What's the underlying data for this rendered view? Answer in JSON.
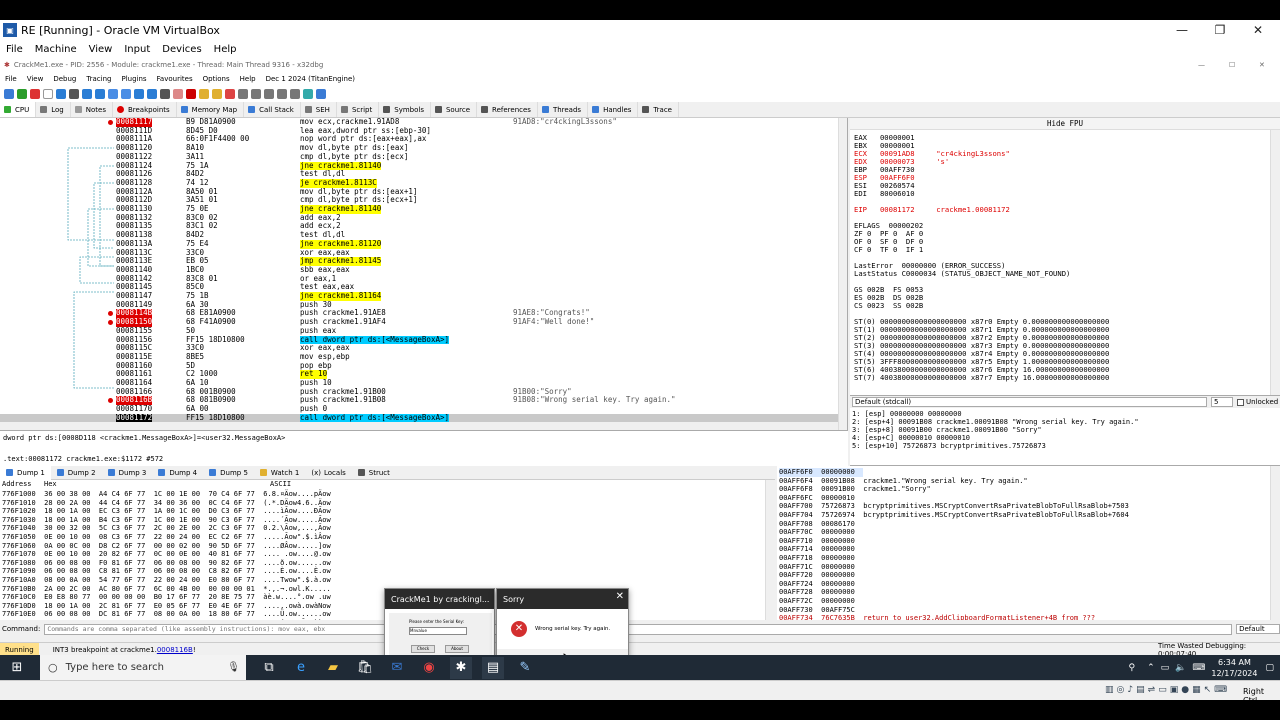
{
  "vbox": {
    "title": "RE [Running] - Oracle VM VirtualBox",
    "menu": [
      "File",
      "Machine",
      "View",
      "Input",
      "Devices",
      "Help"
    ],
    "ctl": [
      "—",
      "❐",
      "✕"
    ]
  },
  "x32": {
    "title": "CrackMe1.exe - PID: 2556 - Module: crackme1.exe - Thread: Main Thread 9316 - x32dbg",
    "menu": [
      "File",
      "View",
      "Debug",
      "Tracing",
      "Plugins",
      "Favourites",
      "Options",
      "Help",
      "Dec 1 2024 (TitanEngine)"
    ],
    "tabs": [
      "CPU",
      "Log",
      "Notes",
      "Breakpoints",
      "Memory Map",
      "Call Stack",
      "SEH",
      "Script",
      "Symbols",
      "Source",
      "References",
      "Threads",
      "Handles",
      "Trace"
    ]
  },
  "disasm": [
    {
      "a": "00081117",
      "b": "B9 D81A0900",
      "i": "mov ecx,crackme1.91AD8",
      "c": "91AD8:\"cr4ckingL3ssons\"",
      "bp": true
    },
    {
      "a": "0008111D",
      "b": "8D45 D0",
      "i": "lea eax,dword ptr ss:[ebp-30]"
    },
    {
      "a": "0008111A",
      "b": "66:0F1F4400 00",
      "i": "nop word ptr ds:[eax+eax],ax"
    },
    {
      "a": "00081120",
      "b": "8A10",
      "i": "mov dl,byte ptr ds:[eax]"
    },
    {
      "a": "00081122",
      "b": "3A11",
      "i": "cmp dl,byte ptr ds:[ecx]"
    },
    {
      "a": "00081124",
      "b": "75 1A",
      "i": "jne crackme1.81140",
      "h": true
    },
    {
      "a": "00081126",
      "b": "84D2",
      "i": "test dl,dl"
    },
    {
      "a": "00081128",
      "b": "74 12",
      "i": "je crackme1.8113C",
      "h": true
    },
    {
      "a": "0008112A",
      "b": "8A50 01",
      "i": "mov dl,byte ptr ds:[eax+1]"
    },
    {
      "a": "0008112D",
      "b": "3A51 01",
      "i": "cmp dl,byte ptr ds:[ecx+1]"
    },
    {
      "a": "00081130",
      "b": "75 0E",
      "i": "jne crackme1.81140",
      "h": true
    },
    {
      "a": "00081132",
      "b": "83C0 02",
      "i": "add eax,2"
    },
    {
      "a": "00081135",
      "b": "83C1 02",
      "i": "add ecx,2"
    },
    {
      "a": "00081138",
      "b": "84D2",
      "i": "test dl,dl"
    },
    {
      "a": "0008113A",
      "b": "75 E4",
      "i": "jne crackme1.81120",
      "h": true
    },
    {
      "a": "0008113C",
      "b": "33C0",
      "i": "xor eax,eax"
    },
    {
      "a": "0008113E",
      "b": "EB 05",
      "i": "jmp crackme1.81145",
      "h": true
    },
    {
      "a": "00081140",
      "b": "1BC0",
      "i": "sbb eax,eax"
    },
    {
      "a": "00081142",
      "b": "83C8 01",
      "i": "or eax,1"
    },
    {
      "a": "00081145",
      "b": "85C0",
      "i": "test eax,eax"
    },
    {
      "a": "00081147",
      "b": "75 1B",
      "i": "jne crackme1.81164",
      "h": true
    },
    {
      "a": "00081149",
      "b": "6A 30",
      "i": "push 30"
    },
    {
      "a": "0008114B",
      "b": "68 E81A0900",
      "i": "push crackme1.91AE8",
      "c": "91AE8:\"Congrats!\"",
      "bp": true
    },
    {
      "a": "00081150",
      "b": "68 F41A0900",
      "i": "push crackme1.91AF4",
      "c": "91AF4:\"Well done!\"",
      "bp": true
    },
    {
      "a": "00081155",
      "b": "50",
      "i": "push eax"
    },
    {
      "a": "00081156",
      "b": "FF15 18D10800",
      "i": "call dword ptr ds:[<MessageBoxA>]",
      "call": true
    },
    {
      "a": "0008115C",
      "b": "33C0",
      "i": "xor eax,eax"
    },
    {
      "a": "0008115E",
      "b": "8BE5",
      "i": "mov esp,ebp"
    },
    {
      "a": "00081160",
      "b": "5D",
      "i": "pop ebp"
    },
    {
      "a": "00081161",
      "b": "C2 1000",
      "i": "ret 10",
      "h": true
    },
    {
      "a": "00081164",
      "b": "6A 10",
      "i": "push 10"
    },
    {
      "a": "00081166",
      "b": "68 001B0900",
      "i": "push crackme1.91B00",
      "c": "91B00:\"Sorry\""
    },
    {
      "a": "0008116B",
      "b": "68 081B0900",
      "i": "push crackme1.91B08",
      "c": "91B08:\"Wrong serial key. Try again.\"",
      "bp": true
    },
    {
      "a": "00081170",
      "b": "6A 00",
      "i": "push 0"
    },
    {
      "a": "00081172",
      "b": "FF15 18D10800",
      "i": "call dword ptr ds:[<MessageBoxA>]",
      "call": true,
      "eip": true
    },
    {
      "a": "00081178",
      "b": "33C0",
      "i": "xor eax,eax"
    }
  ],
  "info": {
    "l1": "dword ptr ds:[0008D118 <crackme1.MessageBoxA>]=<user32.MessageBoxA>",
    "l2": ".text:00081172 crackme1.exe:$1172 #572"
  },
  "regs": {
    "hide": "Hide FPU",
    "lines": [
      "EAX   00000001",
      "EBX   00000001",
      "ECX   00091AD8     \"cr4ckingL3ssons\"",
      "EDX   00000073     's'",
      "EBP   00AFF730",
      "ESP   00AFF6F0",
      "ESI   00260574",
      "EDI   80006010",
      "",
      "EIP   00081172     crackme1.00081172",
      "",
      "EFLAGS  00000202",
      "ZF 0  PF 0  AF 0",
      "OF 0  SF 0  DF 0",
      "CF 0  TF 0  IF 1",
      "",
      "LastError  00000000 (ERROR_SUCCESS)",
      "LastStatus C0000034 (STATUS_OBJECT_NAME_NOT_FOUND)",
      "",
      "GS 002B  FS 0053",
      "ES 002B  DS 002B",
      "CS 0023  SS 002B",
      "",
      "ST(0) 00000000000000000000 x87r0 Empty 0.000000000000000000",
      "ST(1) 00000000000000000000 x87r1 Empty 0.000000000000000000",
      "ST(2) 00000000000000000000 x87r2 Empty 0.000000000000000000",
      "ST(3) 00000000000000000000 x87r3 Empty 0.000000000000000000",
      "ST(4) 00000000000000000000 x87r4 Empty 0.000000000000000000",
      "ST(5) 3FFF8000000000000000 x87r5 Empty 1.000000000000000000",
      "ST(6) 40038000000000000000 x87r6 Empty 16.00000000000000000",
      "ST(7) 40038000000000000000 x87r7 Empty 16.00000000000000000"
    ]
  },
  "callconv": {
    "label": "Default (stdcall)",
    "n": "5",
    "unlocked": "Unlocked"
  },
  "stackargs": [
    "1: [esp] 00000000 00000000",
    "2: [esp+4] 00091B08 crackme1.00091B08 \"Wrong serial key. Try again.\"",
    "3: [esp+8] 00091B00 crackme1.00091B00 \"Sorry\"",
    "4: [esp+C] 00000010 00000010",
    "5: [esp+10] 75726873 bcryptprimitives.75726873"
  ],
  "dumptabs": [
    "Dump 1",
    "Dump 2",
    "Dump 3",
    "Dump 4",
    "Dump 5",
    "Watch 1",
    "Locals",
    "Struct"
  ],
  "dumphdr": {
    "addr": "Address",
    "hex": "Hex",
    "ascii": "ASCII"
  },
  "dump": [
    "776F1000  36 00 38 00  A4 C4 6F 77  1C 00 1E 00  70 C4 6F 77  6.8.¤Äow....pÄow",
    "776F1010  28 00 2A 00  44 C4 6F 77  34 00 36 00  0C C4 6F 77  (.*.DÄow4.6..Äow",
    "776F1020  18 00 1A 00  EC C3 6F 77  1A 00 1C 00  D0 C3 6F 77  ....ìÃow....ÐÃow",
    "776F1030  18 00 1A 00  B4 C3 6F 77  1C 00 1E 00  90 C3 6F 77  ....´Ãow.....Ãow",
    "776F1040  30 00 32 00  5C C3 6F 77  2C 00 2E 00  2C C3 6F 77  0.2.\\Ãow,...,Ãow",
    "776F1050  0E 00 10 00  08 C3 6F 77  22 00 24 00  EC C2 6F 77  .....Ãow\".$.ìÂow",
    "776F1060  0A 00 0C 00  D8 C2 6F 77  00 00 02 00  90 5D 6F 77  ....ØÂow.....]ow",
    "776F1070  0E 00 10 00  20 82 6F 77  0C 00 0E 00  40 81 6F 77  .... .ow....@.ow",
    "776F1080  06 00 08 00  F0 81 6F 77  06 00 08 00  90 82 6F 77  ....ð.ow......ow",
    "776F1090  06 00 08 00  C8 81 6F 77  06 00 08 00  C8 82 6F 77  ....È.ow....È.ow",
    "776F10A0  08 00 0A 00  54 77 6F 77  22 00 24 00  E0 80 6F 77  ....Twow\".$.à.ow",
    "776F10B0  2A 00 2C 00  AC 80 6F 77  6C 00 4B 00  00 00 00 01  *.,.¬.owl.K.....",
    "776F10C0  E0 E8 80 77  00 00 00 00  B0 17 6F 77  20 8E 75 77  àè.w....°.ow .uw",
    "776F10D0  18 00 1A 00  2C 81 6F 77  E0 05 6F 77  E0 4E 6F 77  ....,.owà.owàNow",
    "776F10E0  06 00 08 00  DC 81 6F 77  08 00 0A 00  18 80 6F 77  ....Ü.ow......ow",
    "776F10F0  02 00 04 00  B4 E6 6E 77  40 D5 75 77  E0 F2 73 77  ....´ænw@Õuwàòsw",
    "776F1100  18 00 1A 00  50 78 6F 77  50 00 1A 00  64 48 6E 77  ....PxowP...dHnw"
  ],
  "stack": [
    "00AFF6F0  00000000  ",
    "00AFF6F4  00091B08  crackme1.\"Wrong serial key. Try again.\"",
    "00AFF6F8  00091B00  crackme1.\"Sorry\"",
    "00AFF6FC  00000010  ",
    "00AFF700  75726873  bcryptprimitives.MSCryptConvertRsaPrivateBlobToFullRsaBlob+7503",
    "00AFF704  75726974  bcryptprimitives.MSCryptConvertRsaPrivateBlobToFullRsaBlob+7604",
    "00AFF708  00086170  ",
    "00AFF70C  00000000  ",
    "00AFF710  00000000  ",
    "00AFF714  00000000  ",
    "00AFF718  00000000  ",
    "00AFF71C  00000000  ",
    "00AFF720  00000000  ",
    "00AFF724  00000000  ",
    "00AFF728  00000000  ",
    "00AFF72C  00000000  ",
    "00AFF730  00AFF75C  ",
    "00AFF734  76C7635B  return to user32.AddClipboardFormatListener+4B from ???",
    "00AFF738  0026057A  "
  ],
  "cmd": {
    "label": "Command:",
    "placeholder": "Commands are comma separated (like assembly instructions): mov eax, ebx",
    "mode": "Default"
  },
  "status": {
    "state": "Running",
    "msg": "INT3 breakpoint at crackme1.",
    "link": "0008116B",
    "suffix": "!",
    "time": "Time Wasted Debugging: 0:00:07:40"
  },
  "dlg1": {
    "title": "CrackMe1 by crackingl...",
    "prompt": "Please enter the Serial Key:",
    "value": "Mnvalue",
    "check": "Check",
    "about": "About"
  },
  "dlg2": {
    "title": "Sorry",
    "msg": "Wrong serial key. Try again.",
    "ok": "OK"
  },
  "taskbar": {
    "search": "Type here to search",
    "time": "6:34 AM",
    "date": "12/17/2024"
  },
  "vbstatus": {
    "hostkey": "Right Ctrl"
  }
}
